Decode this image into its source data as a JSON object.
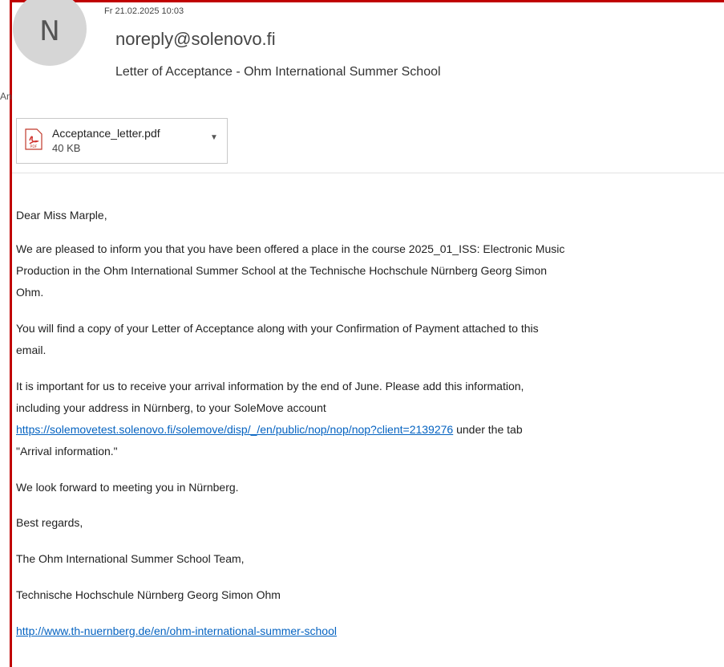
{
  "email": {
    "date": "Fr 21.02.2025 10:03",
    "avatar_initial": "N",
    "sender": "noreply@solenovo.fi",
    "subject": "Letter of Acceptance - Ohm International Summer School",
    "to_label": "An",
    "attachment": {
      "name": "Acceptance_letter.pdf",
      "size": "40 KB",
      "icon": "pdf-icon"
    },
    "body": {
      "greeting": "Dear Miss Marple,",
      "p1_l1": "We are pleased to inform you that you have been offered a place in the course 2025_01_ISS: Electronic Music",
      "p1_l2": "Production in the Ohm International Summer School at the Technische Hochschule Nürnberg Georg Simon",
      "p1_l3": "Ohm.",
      "p2_l1": "You will find a copy of your Letter of Acceptance along with your Confirmation of Payment attached to this",
      "p2_l2": "email.",
      "p3_l1": "It is important for us to receive your arrival information by the end of June. Please add this information,",
      "p3_l2": "including your address in Nürnberg, to your SoleMove account",
      "p3_link": "https://solemovetest.solenovo.fi/solemove/disp/_/en/public/nop/nop/nop?client=2139276",
      "p3_after_link": " under the tab",
      "p3_l4": "\"Arrival information.\"",
      "p4": "We look forward to meeting you in Nürnberg.",
      "closing": "Best regards,",
      "team": "The Ohm International Summer School Team,",
      "university": "Technische Hochschule Nürnberg Georg Simon Ohm",
      "website_link": "http://www.th-nuernberg.de/en/ohm-international-summer-school"
    }
  },
  "colors": {
    "frame": "#c00000",
    "link": "#0563c1",
    "avatar_bg": "#d6d6d6"
  }
}
